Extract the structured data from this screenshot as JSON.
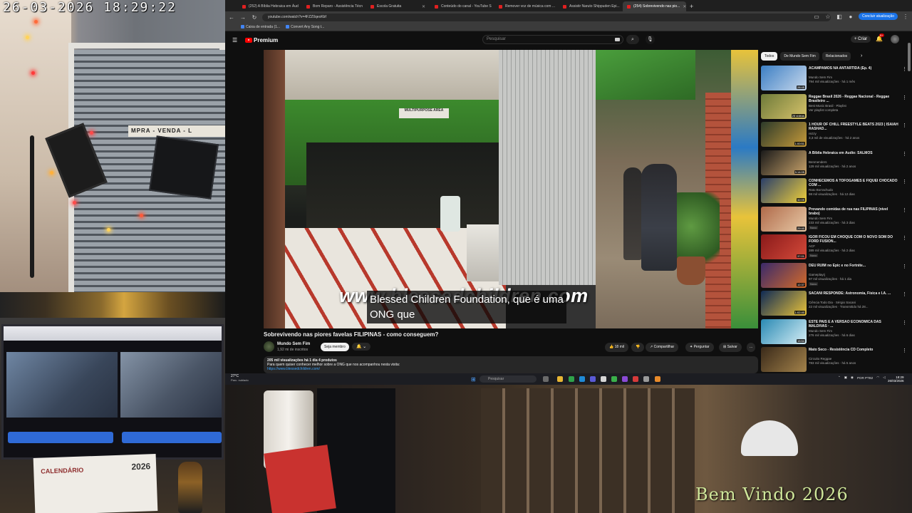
{
  "overlay": {
    "timestamp": "26-03-2026  18:29:22",
    "welcome": "Bem Vindo 2026",
    "room_sign": "MPRA - VENDA - L",
    "calendar_label": "CALENDÁRIO",
    "calendar_year": "2026"
  },
  "browser": {
    "tabs": [
      {
        "label": "(252) A Bíblia Hebraica em Áud",
        "active": false
      },
      {
        "label": "Bom Reparo - Assistência Técn",
        "active": false
      },
      {
        "label": "Escola Gratuita",
        "active": false
      },
      {
        "label": "Conteúdo do canal - YouTube S",
        "active": false
      },
      {
        "label": "Remover voz de música com ...",
        "active": false
      },
      {
        "label": "Assistir Naruto Shippuden Epi...",
        "active": false
      },
      {
        "label": "(254) Sobrevivendo nas pio...",
        "active": true
      }
    ],
    "url": "youtube.com/watch?v=4FZZ0qeoKbf",
    "update_button": "Concluir atualização",
    "bookmarks": [
      "Caixa de entrada (1...",
      "Convert Any Song t..."
    ]
  },
  "youtube": {
    "logo": "Premium",
    "search_placeholder": "Pesquisar",
    "create_label": "+ Criar",
    "notif_badge": "9+",
    "video": {
      "sign": "MULTIPURPOSE AREA",
      "subtitle_url": "www.blessedchildren.com",
      "subtitle_line1": "Blessed Children Foundation, que é uma",
      "subtitle_line2": "ONG que"
    },
    "title": "Sobrevivendo nas piores favelas FILIPINAS - como conseguem?",
    "channel": "Mundo Sem Fim",
    "subscribers": "1,92 mi de inscritos",
    "join_label": "Seja membro",
    "bell_label": "🔔 ⌄",
    "like_count": "18 mil",
    "share_label": "Compartilhar",
    "ask_label": "Perguntar",
    "save_label": "Salvar",
    "more_label": "...",
    "description": {
      "stats": "205 mil visualizações  há 1 dia  4 produtos",
      "line": "Para quem quiser conhecer melhor sobre a ONG que nos acompanhou nesta visita:",
      "link": "https://www.blessedchildren.com/"
    },
    "chips": [
      "Todos",
      "De Mundo Sem Fim",
      "Relacionados"
    ],
    "recommendations": [
      {
        "title": "ACAMPAMOS NA ANTÁRTIDA (Ep. 4)",
        "channel": "Mundo Sem Fim",
        "meta": "794 mil visualizações · há 1 mês",
        "duration": "28:45",
        "badge": "",
        "color1": "#3c7fc4",
        "color2": "#c8d8ec"
      },
      {
        "title": "Reggae Brasil 2026 - Reggae Nacional - Reggae Brasileiro ...",
        "channel": "Best Music Brasil · Playlist",
        "meta": "Ver playlist completa",
        "duration": "25 vídeos",
        "badge": "",
        "color1": "#6e7a3a",
        "color2": "#d7c36a"
      },
      {
        "title": "1 HOUR OF CHILL FREESTYLE BEATS 2023 | ISAIAH RASHAD...",
        "channel": "rezzy",
        "meta": "3,3 mil de visualizações · há 2 anos",
        "duration": "1:00:51",
        "badge": "",
        "color1": "#2c3a2a",
        "color2": "#c69a3a"
      },
      {
        "title": "A Bíblia Hebraica em Áudio: SALMOS",
        "channel": "Benmenders",
        "meta": "129 mil visualizações · há 2 anos",
        "duration": "5:14:05",
        "badge": "",
        "color1": "#1a1a1a",
        "color2": "#c9a36a"
      },
      {
        "title": "CONHECEMOS A TOFOGAMES E FIQUEI CHOCADO COM ...",
        "channel": "Rato Borrachudo",
        "meta": "98 mil visualizações · há 12 dias",
        "duration": "32:09",
        "badge": "",
        "color1": "#2a3f6a",
        "color2": "#f0d03a"
      },
      {
        "title": "Provando comidas de rua nas FILIPINAS (nível brabo)",
        "channel": "Mundo Sem Fim",
        "meta": "233 mil visualizações · há 3 dias",
        "duration": "29:40",
        "badge": "Novo",
        "color1": "#b06a4a",
        "color2": "#e7c9a6"
      },
      {
        "title": "IGOR FICOU EM CHOQUE COM O NOVO SOM DO FORD FUSION...",
        "channel": "ACF",
        "meta": "389 mil visualizações · há 2 dias",
        "duration": "37:01",
        "badge": "Novo",
        "color1": "#8a1a1a",
        "color2": "#d44a3a"
      },
      {
        "title": "DEU RUIM no Epic e no Fortnite...",
        "channel": "Gameplayrj",
        "meta": "97 mil visualizações · há 1 dia",
        "duration": "12:37",
        "badge": "Novo",
        "color1": "#3a2a6a",
        "color2": "#d46a2a"
      },
      {
        "title": "SACANI RESPONDE: Astronomia, Física e I.A. ...",
        "channel": "Ciência Todo Dia · Sérgio Sacani",
        "meta": "22 mil visualizações · Transmitido há 28...",
        "duration": "1:02:40",
        "badge": "",
        "color1": "#0f2a55",
        "color2": "#e8c23a"
      },
      {
        "title": "ESTE PAÍS É A VERSÃO ECONÔMICA DAS MALDIVAS · ...",
        "channel": "Mundo Sem Fim",
        "meta": "276 mil visualizações · há 6 dias",
        "duration": "15:54",
        "badge": "",
        "color1": "#2a8ab4",
        "color2": "#d7eef5"
      },
      {
        "title": "Mato Seco - Resistência CD Completo",
        "channel": "Circuito Reggae",
        "meta": "783 mil visualizações · há 5 anos",
        "duration": "",
        "badge": "",
        "color1": "#3a2a1a",
        "color2": "#a3824a"
      }
    ]
  },
  "taskbar": {
    "weather_temp": "27°C",
    "weather_desc": "Parc. nublado",
    "search_placeholder": "Pesquisar",
    "tray_lang": "POR PTB2",
    "time": "18:29",
    "date": "26/03/2026"
  }
}
